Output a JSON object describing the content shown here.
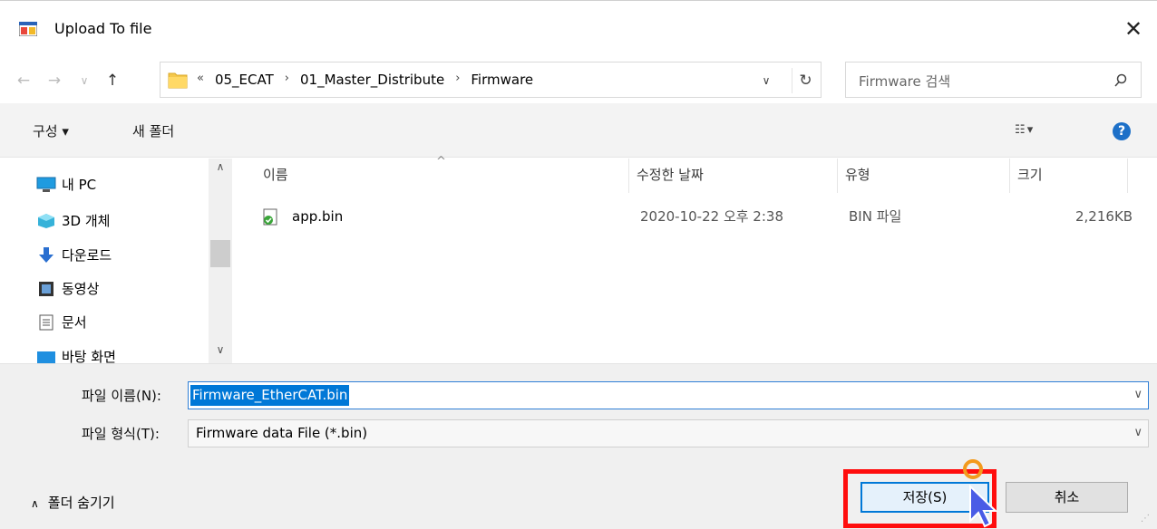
{
  "window": {
    "title": "Upload To file"
  },
  "nav": {
    "back": "←",
    "forward": "→",
    "recent": "∨",
    "up": "↑",
    "breadcrumb": {
      "overflow": "«",
      "items": [
        "05_ECAT",
        "01_Master_Distribute",
        "Firmware"
      ],
      "separator": "›"
    },
    "search_placeholder": "Firmware 검색"
  },
  "toolbar": {
    "organize": "구성 ▾",
    "new_folder": "새 폴더"
  },
  "sidebar": {
    "items": [
      "내 PC",
      "3D 개체",
      "다운로드",
      "동영상",
      "문서",
      "바탕 화면"
    ]
  },
  "columns": {
    "name": "이름",
    "date": "수정한 날짜",
    "type": "유형",
    "size": "크기"
  },
  "files": [
    {
      "name": "app.bin",
      "date": "2020-10-22 오후 2:38",
      "type": "BIN 파일",
      "size": "2,216KB"
    }
  ],
  "form": {
    "filename_label": "파일 이름(N):",
    "filename_value": "Firmware_EtherCAT.bin",
    "filetype_label": "파일 형식(T):",
    "filetype_value": "Firmware data File  (*.bin)"
  },
  "footer": {
    "hide_folders": "폴더 숨기기",
    "save": "저장(S)",
    "cancel": "취소"
  },
  "colors": {
    "accent": "#0078d7",
    "highlight": "#ff0d0d",
    "help": "#1d70c8"
  }
}
